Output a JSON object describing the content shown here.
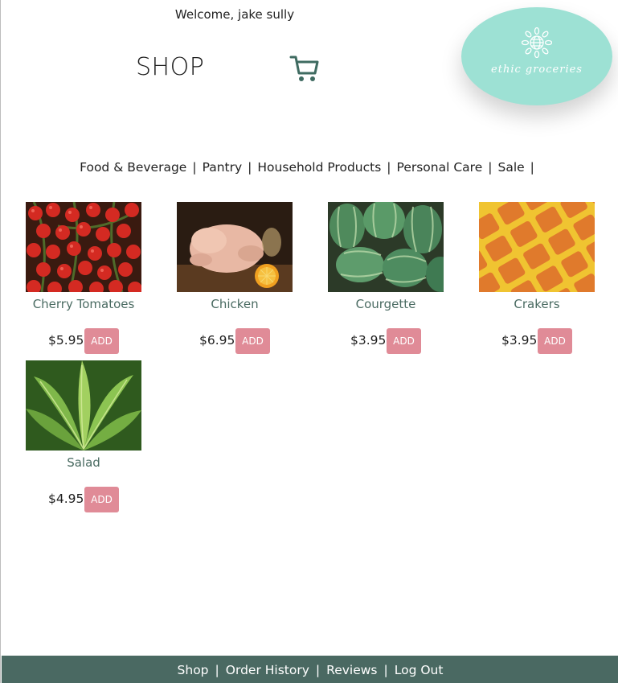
{
  "header": {
    "welcome": "Welcome, jake sully",
    "shop_title": "SHOP",
    "cart_icon": "shopping-cart-icon",
    "logo_text": "ethic groceries",
    "logo_icon": "flower-globe-icon",
    "logo_color": "#9de1d4"
  },
  "categories": [
    {
      "label": "Food & Beverage"
    },
    {
      "label": "Pantry"
    },
    {
      "label": "Household Products"
    },
    {
      "label": "Personal Care"
    },
    {
      "label": "Sale"
    }
  ],
  "separator": "|",
  "products": [
    {
      "name": "Cherry Tomatoes",
      "price": "$5.95",
      "add_label": "ADD"
    },
    {
      "name": "Chicken",
      "price": "$6.95",
      "add_label": "ADD"
    },
    {
      "name": "Courgette",
      "price": "$3.95",
      "add_label": "ADD"
    },
    {
      "name": "Crakers",
      "price": "$3.95",
      "add_label": "ADD"
    },
    {
      "name": "Salad",
      "price": "$4.95",
      "add_label": "ADD"
    }
  ],
  "footer": {
    "links": [
      {
        "label": "Shop"
      },
      {
        "label": "Order History"
      },
      {
        "label": "Reviews"
      },
      {
        "label": "Log Out"
      }
    ],
    "color": "#4a6962"
  },
  "colors": {
    "accent_button": "#e08b97",
    "product_name": "#4a6b62"
  }
}
